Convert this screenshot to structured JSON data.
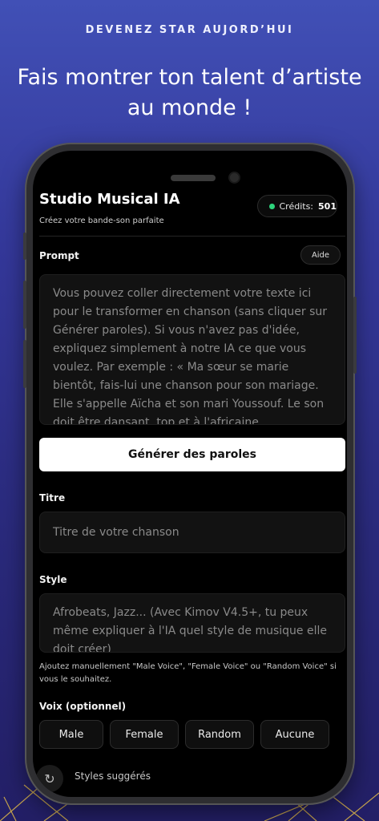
{
  "promo": {
    "kicker": "DEVENEZ STAR AUJORD’HUI",
    "headline_line1": "Fais montrer ton talent d’artiste",
    "headline_line2": "au monde !"
  },
  "app": {
    "title": "Studio Musical IA",
    "subtitle": "Créez votre bande-son parfaite",
    "credits_label": "Crédits:",
    "credits_value": "501",
    "credits_status_color": "#2dd47c"
  },
  "prompt": {
    "label": "Prompt",
    "help_button": "Aide",
    "text": "Vous pouvez coller directement votre texte ici pour le transformer en chanson (sans cliquer sur Générer paroles). Si vous n'avez pas d'idée, expliquez simplement à notre IA ce que vous voulez. Par exemple : « Ma sœur se marie bientôt, fais-lui une chanson pour son mariage. Elle s'appelle Aïcha et son mari Youssouf. Le son doit être dansant, top et à l'africaine"
  },
  "generate_button": "Générer des paroles",
  "title_field": {
    "label": "Titre",
    "placeholder": "Titre de votre chanson"
  },
  "style_field": {
    "label": "Style",
    "placeholder": "Afrobeats, Jazz... (Avec Kimov V4.5+, tu peux même expliquer à l'IA quel style de musique elle doit créer)"
  },
  "hint": "Ajoutez manuellement \"Male Voice\", \"Female Voice\" ou \"Random Voice\" si vous le souhaitez.",
  "voice": {
    "label": "Voix (optionnel)",
    "options": [
      "Male",
      "Female",
      "Random",
      "Aucune"
    ]
  },
  "suggested_styles": "Styles suggérés"
}
